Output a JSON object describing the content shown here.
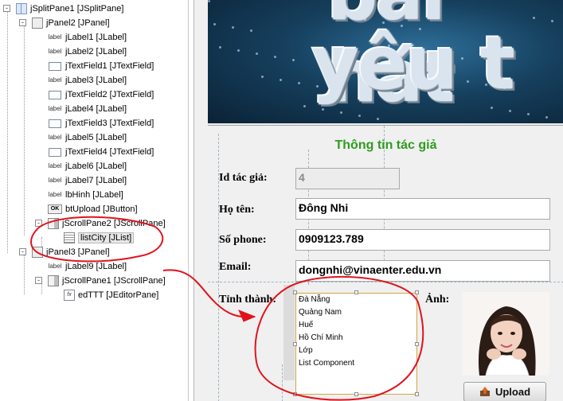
{
  "tree": {
    "nodes": [
      {
        "label": "jSplitPane1 [JSplitPane]",
        "icon": "split-pane-icon",
        "expander": "-"
      },
      {
        "label": "jPanel2 [JPanel]",
        "icon": "panel-icon",
        "expander": "-"
      },
      {
        "label": "jLabel1 [JLabel]",
        "icon": "label-icon",
        "icon_text": "label"
      },
      {
        "label": "jLabel2 [JLabel]",
        "icon": "label-icon",
        "icon_text": "label"
      },
      {
        "label": "jTextField1 [JTextField]",
        "icon": "text-field-icon"
      },
      {
        "label": "jLabel3 [JLabel]",
        "icon": "label-icon",
        "icon_text": "label"
      },
      {
        "label": "jTextField2 [JTextField]",
        "icon": "text-field-icon"
      },
      {
        "label": "jLabel4 [JLabel]",
        "icon": "label-icon",
        "icon_text": "label"
      },
      {
        "label": "jTextField3 [JTextField]",
        "icon": "text-field-icon"
      },
      {
        "label": "jLabel5 [JLabel]",
        "icon": "label-icon",
        "icon_text": "label"
      },
      {
        "label": "jTextField4 [JTextField]",
        "icon": "text-field-icon"
      },
      {
        "label": "jLabel6 [JLabel]",
        "icon": "label-icon",
        "icon_text": "label"
      },
      {
        "label": "jLabel7 [JLabel]",
        "icon": "label-icon",
        "icon_text": "label"
      },
      {
        "label": "lbHinh [JLabel]",
        "icon": "label-icon",
        "icon_text": "label"
      },
      {
        "label": "btUpload [JButton]",
        "icon": "button-icon",
        "icon_text": "OK"
      },
      {
        "label": "jScrollPane2 [JScrollPane]",
        "icon": "scroll-pane-icon",
        "expander": "-"
      },
      {
        "label": "listCity [JList]",
        "icon": "list-icon",
        "selected": true
      },
      {
        "label": "jPanel3 [JPanel]",
        "icon": "panel-icon",
        "expander": "-"
      },
      {
        "label": "jLabel9 [JLabel]",
        "icon": "label-icon",
        "icon_text": "label"
      },
      {
        "label": "jScrollPane1 [JScrollPane]",
        "icon": "scroll-pane-icon",
        "expander": "-"
      },
      {
        "label": "edTTT [JEditorPane]",
        "icon": "editor-pane-icon",
        "icon_text": "fx"
      }
    ]
  },
  "form": {
    "title": "Thông tin tác giả",
    "id_label": "Id tác giả:",
    "id_value": "4",
    "name_label": "Họ tên:",
    "name_value": "Đông Nhi",
    "phone_label": "Số phone:",
    "phone_value": "0909123.789",
    "email_label": "Email:",
    "email_value": "dongnhi@vinaenter.edu.vn",
    "city_label": "Tỉnh thành:",
    "photo_label": "Ảnh:",
    "upload_label": "Upload",
    "upload_icon": "upload-icon",
    "city_items": [
      "Đà Nẵng",
      "Quảng Nam",
      "Huế",
      "Hồ Chí Minh",
      "Lớp",
      "List Component"
    ]
  },
  "banner": {
    "line1": "bài hát",
    "line2": "yêu t"
  },
  "colors": {
    "title_green": "#2e9c1e",
    "annotation_red": "#e0141e",
    "list_border": "#d1a640"
  }
}
